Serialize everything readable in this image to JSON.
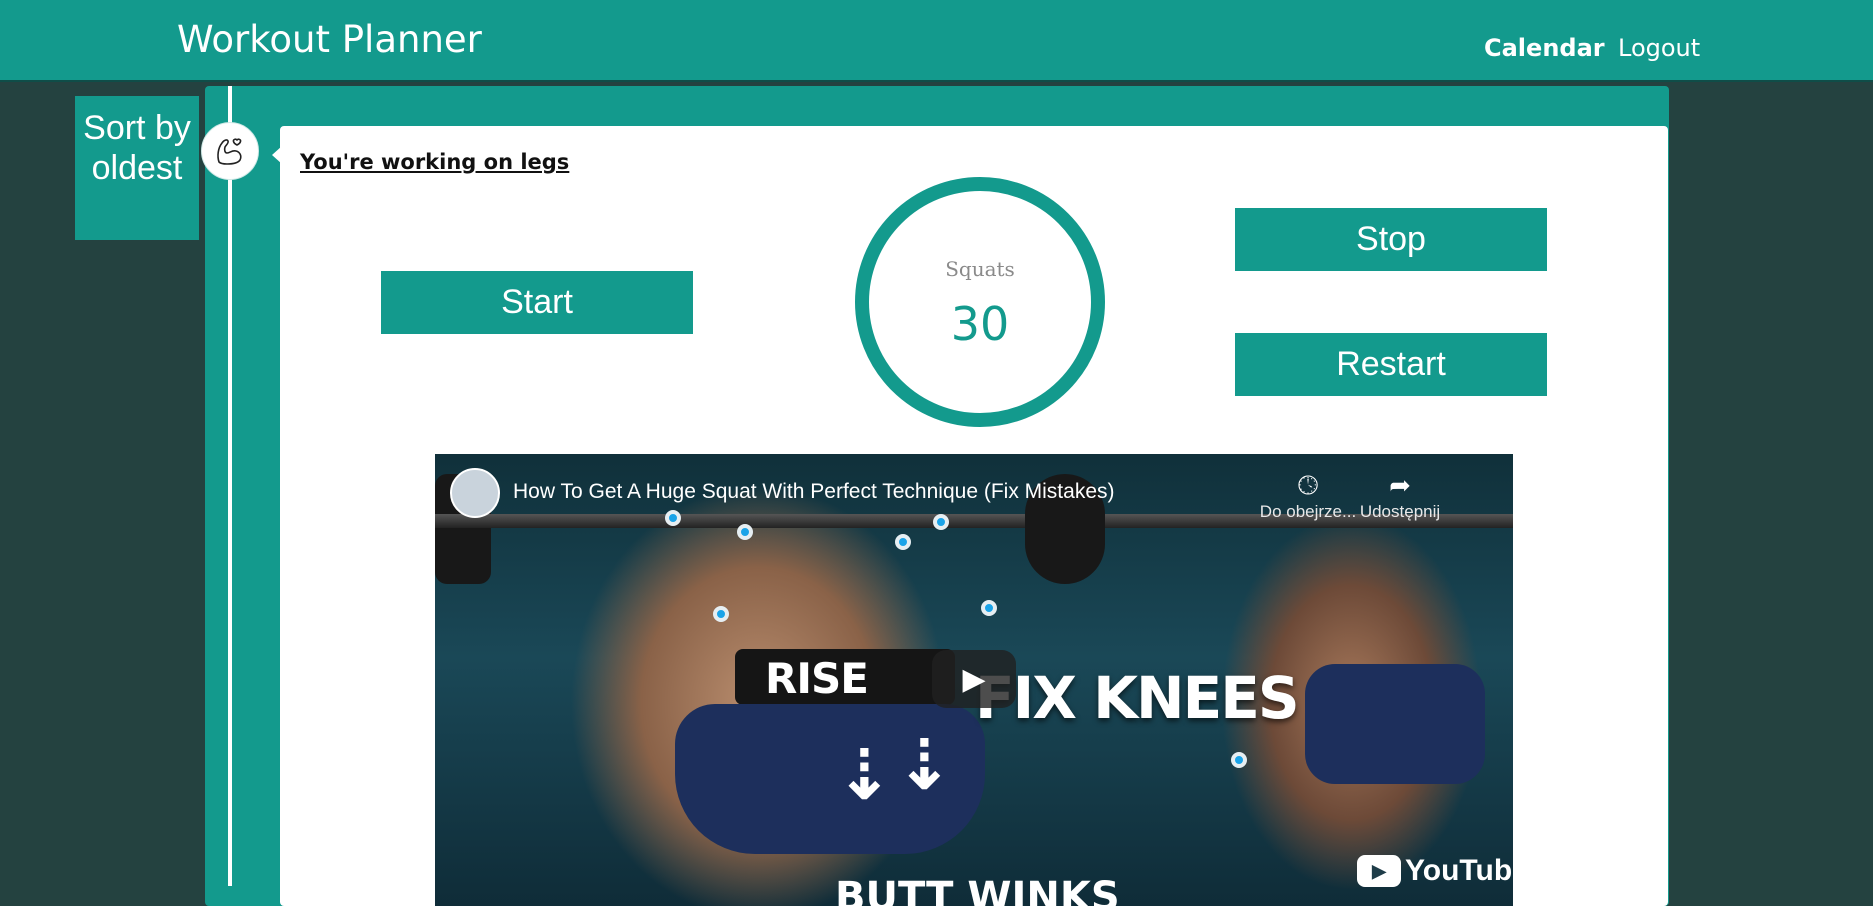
{
  "navbar": {
    "brand": "Workout Planner",
    "links": [
      {
        "label": "Calendar",
        "active": true
      },
      {
        "label": "Logout",
        "active": false
      }
    ]
  },
  "sort_button": {
    "label": "Sort by oldest"
  },
  "timeline": {
    "badge_icon": "flexed-arm-heart-icon"
  },
  "workout": {
    "heading": "You're working on legs",
    "start_label": "Start",
    "stop_label": "Stop",
    "restart_label": "Restart",
    "exercise_name": "Squats",
    "count": "30"
  },
  "video": {
    "title": "How To Get A Huge Squat With Perfect Technique (Fix Mistakes)",
    "watch_later_label": "Do obejrze...",
    "share_label": "Udostępnij",
    "thumbnail_text_main": "FIX KNEES",
    "thumbnail_text_belt": "RISE",
    "thumbnail_text_bottom": "BUTT WINKS",
    "brand_label": "YouTube"
  },
  "colors": {
    "accent": "#139a8d",
    "background": "#244240",
    "card": "#ffffff"
  }
}
